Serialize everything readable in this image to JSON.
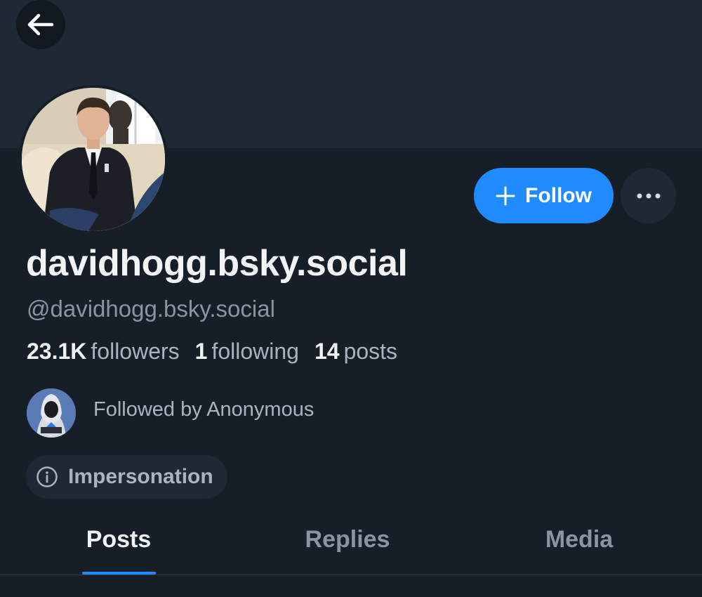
{
  "profile": {
    "display_name": "davidhogg.bsky.social",
    "handle": "@davidhogg.bsky.social"
  },
  "actions": {
    "follow_label": "Follow"
  },
  "stats": {
    "followers_count": "23.1K",
    "followers_label": "followers",
    "following_count": "1",
    "following_label": "following",
    "posts_count": "14",
    "posts_label": "posts"
  },
  "followed_by": {
    "text": "Followed by Anonymous"
  },
  "labels": {
    "impersonation": "Impersonation"
  },
  "tabs": [
    {
      "label": "Posts",
      "active": true
    },
    {
      "label": "Replies",
      "active": false
    },
    {
      "label": "Media",
      "active": false
    }
  ],
  "colors": {
    "accent": "#208bfe",
    "background": "#161e27",
    "banner": "#1e2935"
  }
}
